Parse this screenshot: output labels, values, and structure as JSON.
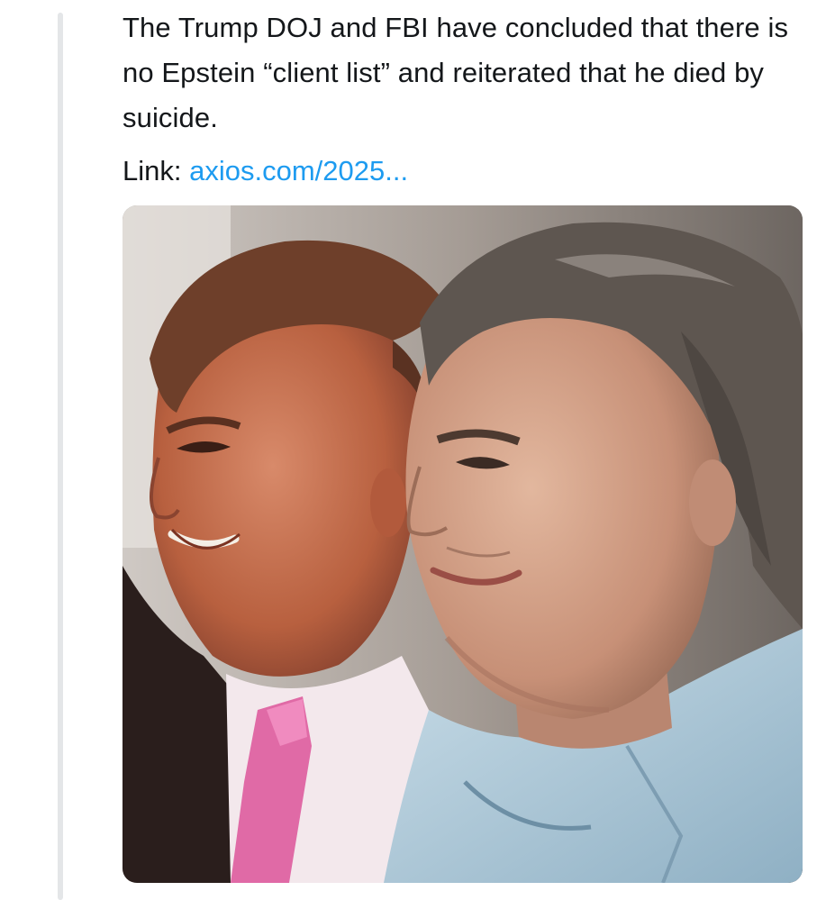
{
  "post": {
    "text": "The Trump DOJ and FBI have concluded that there is no Epstein “client list” and reiterated that he died by suicide.",
    "link_label": "Link:",
    "link_url": "axios.com/2025..."
  },
  "media": {
    "type": "photo"
  }
}
